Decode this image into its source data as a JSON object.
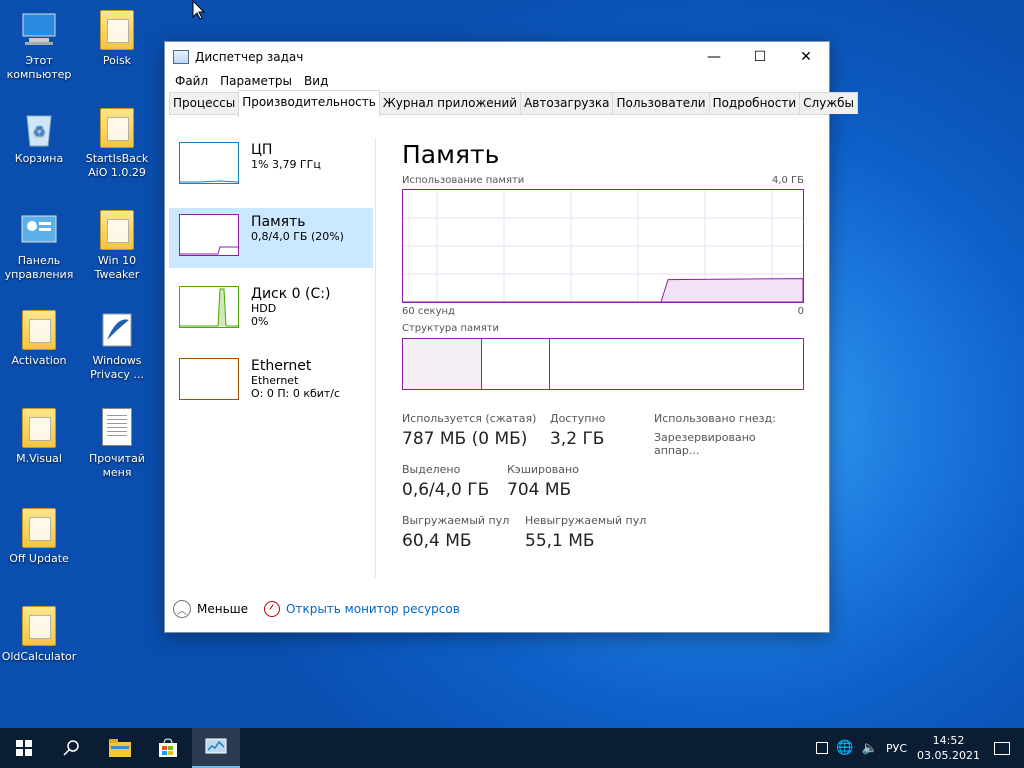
{
  "desktop": {
    "icons": [
      {
        "label": "Этот компьютер"
      },
      {
        "label": "Poisk"
      },
      {
        "label": "Корзина"
      },
      {
        "label": "StartIsBack AiO 1.0.29"
      },
      {
        "label": "Панель управления"
      },
      {
        "label": "Win 10 Tweaker"
      },
      {
        "label": "Activation"
      },
      {
        "label": "Windows Privacy ..."
      },
      {
        "label": "M.Visual"
      },
      {
        "label": "Прочитай меня"
      },
      {
        "label": "Off Update"
      },
      {
        "label": "OldCalculator"
      }
    ]
  },
  "window": {
    "title": "Диспетчер задач",
    "controls": {
      "minimize": "—",
      "maximize": "☐",
      "close": "✕"
    },
    "menu": [
      "Файл",
      "Параметры",
      "Вид"
    ],
    "tabs": [
      "Процессы",
      "Производительность",
      "Журнал приложений",
      "Автозагрузка",
      "Пользователи",
      "Подробности",
      "Службы"
    ],
    "active_tab": 1,
    "resources": [
      {
        "name": "ЦП",
        "line2": "1% 3,79 ГГц",
        "line3": "",
        "color": "#1d7fb8"
      },
      {
        "name": "Память",
        "line2": "0,8/4,0 ГБ (20%)",
        "line3": "",
        "color": "#8b1fa9"
      },
      {
        "name": "Диск 0 (C:)",
        "line2": "HDD",
        "line3": "0%",
        "color": "#4da60c"
      },
      {
        "name": "Ethernet",
        "line2": "Ethernet",
        "line3": "О: 0 П: 0 кбит/с",
        "color": "#a74f01"
      }
    ],
    "memory": {
      "title": "Память",
      "usage_label": "Использование памяти",
      "usage_max": "4,0 ГБ",
      "time_left": "60 секунд",
      "time_right": "0",
      "usage_fraction": 0.2,
      "structure_label": "Структура памяти",
      "stats": {
        "in_use_label": "Используется (сжатая)",
        "in_use_value": "787 МБ (0 МБ)",
        "available_label": "Доступно",
        "available_value": "3,2 ГБ",
        "slots_label": "Использовано гнезд:",
        "reserved_label": "Зарезервировано аппар...",
        "committed_label": "Выделено",
        "committed_value": "0,6/4,0 ГБ",
        "cached_label": "Кэшировано",
        "cached_value": "704 МБ",
        "paged_label": "Выгружаемый пул",
        "paged_value": "60,4 МБ",
        "nonpaged_label": "Невыгружаемый пул",
        "nonpaged_value": "55,1 МБ"
      }
    },
    "footer": {
      "less": "Меньше",
      "resmon": "Открыть монитор ресурсов"
    }
  },
  "taskbar": {
    "lang": "РУС",
    "time": "14:52",
    "date": "03.05.2021"
  }
}
